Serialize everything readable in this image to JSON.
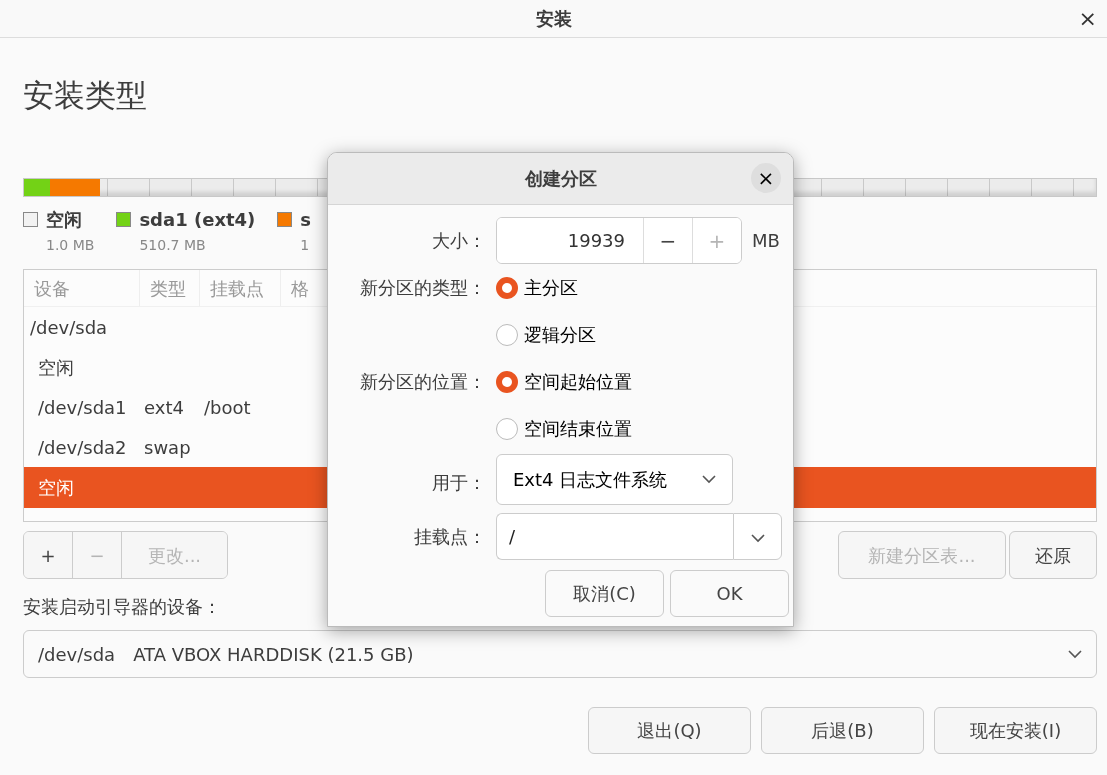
{
  "window": {
    "title": "安装",
    "close": "×"
  },
  "heading": "安装类型",
  "partition_bar": {
    "segments": [
      {
        "color": "#73d216",
        "level": 0.024
      },
      {
        "color": "#f57900",
        "level": 0.047
      }
    ]
  },
  "legend": [
    {
      "label": "空闲",
      "size": "1.0 MB",
      "color": "#f2f2f2"
    },
    {
      "label": "sda1 (ext4)",
      "size": "510.7 MB",
      "color": "#73d216"
    },
    {
      "label": "s",
      "size": "1",
      "color": "#f57900"
    }
  ],
  "table": {
    "columns": [
      "设备",
      "类型",
      "挂载点",
      "格"
    ],
    "rows": [
      {
        "device": "/dev/sda",
        "selected": false,
        "children": [
          {
            "device": "空闲",
            "selected": false
          },
          {
            "device": "/dev/sda1",
            "type": "ext4",
            "mount": "/boot",
            "selected": false
          },
          {
            "device": "/dev/sda2",
            "type": "swap",
            "selected": false
          },
          {
            "device": "空闲",
            "selected": true
          }
        ]
      }
    ]
  },
  "table_tools": [
    {
      "label": "+",
      "disabled": false
    },
    {
      "label": "−",
      "disabled": true
    },
    {
      "label": "更改...",
      "disabled": true
    }
  ],
  "table_actions": [
    {
      "label": "新建分区表...",
      "disabled": true
    },
    {
      "label": "还原",
      "disabled": false
    }
  ],
  "boot_device": {
    "label": "安装启动引导器的设备：",
    "device": "/dev/sda",
    "description": "ATA VBOX HARDDISK (21.5 GB)"
  },
  "buttons": [
    "退出(Q)",
    "后退(B)",
    "现在安装(I)"
  ],
  "dialog": {
    "title": "创建分区",
    "close": "×",
    "size": {
      "label": "大小：",
      "value": "19939",
      "minus": "−",
      "plus": "+",
      "minus_disabled": false,
      "plus_disabled": true,
      "unit": "MB"
    },
    "type": {
      "label": "新分区的类型：",
      "options": [
        {
          "label": "主分区",
          "selected": true
        },
        {
          "label": "逻辑分区",
          "selected": false
        }
      ]
    },
    "location": {
      "label": "新分区的位置：",
      "options": [
        {
          "label": "空间起始位置",
          "selected": true
        },
        {
          "label": "空间结束位置",
          "selected": false
        }
      ]
    },
    "use_as": {
      "label": "用于：",
      "value": "Ext4 日志文件系统"
    },
    "mount_point": {
      "label": "挂载点：",
      "value": "/"
    },
    "buttons": [
      "取消(C)",
      "OK"
    ]
  }
}
